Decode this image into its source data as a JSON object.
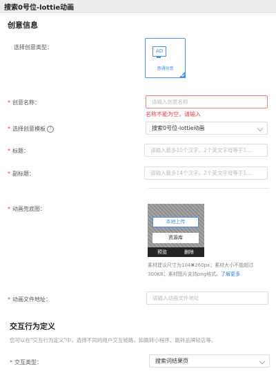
{
  "header": {
    "title": "搜索0号位-lottie动画"
  },
  "sections": {
    "creative_info": "创意信息",
    "interaction": "交互行为定义"
  },
  "form": {
    "creative_type_label": "选择创意类型：",
    "creative_card": {
      "icon_text": "AD",
      "caption": "普通创意"
    },
    "name_label": "创意名称：",
    "name_placeholder": "请输入创意名称",
    "name_error": "名称不能为空，请输入",
    "template_label": "选择创意模板",
    "template_value": "搜索0号位-lottie动画",
    "title_label": "标题：",
    "title_placeholder": "请输入最多10个汉字，2个英文字母等于1...",
    "subtitle_label": "副标题：",
    "subtitle_placeholder": "请输入最多14个汉字，2个英文字母等于1...",
    "cover_label": "动画兜底图：",
    "upload": {
      "local_btn": "本地上传",
      "library_btn": "资源库",
      "preview": "预览",
      "delete": "删除"
    },
    "material_hint_line1": "素材建议尺寸为104✖260px；素材大小不能超过",
    "material_hint_line2": "300KB；素材图片支持png格式。",
    "learn_more": "了解更多",
    "anim_file_label": "动画文件地址：",
    "anim_file_placeholder": "请输入动画文件地址",
    "interaction_desc": "您可以在\"交互行为定义\"中，选择不同的用户交互链路，如跳转小程序、跳转品牌轻店等。",
    "interaction_type_label": "交互类型：",
    "interaction_type_value": "搜索词结果页"
  },
  "colors": {
    "accent": "#4a8fe7",
    "error": "#e64340"
  }
}
